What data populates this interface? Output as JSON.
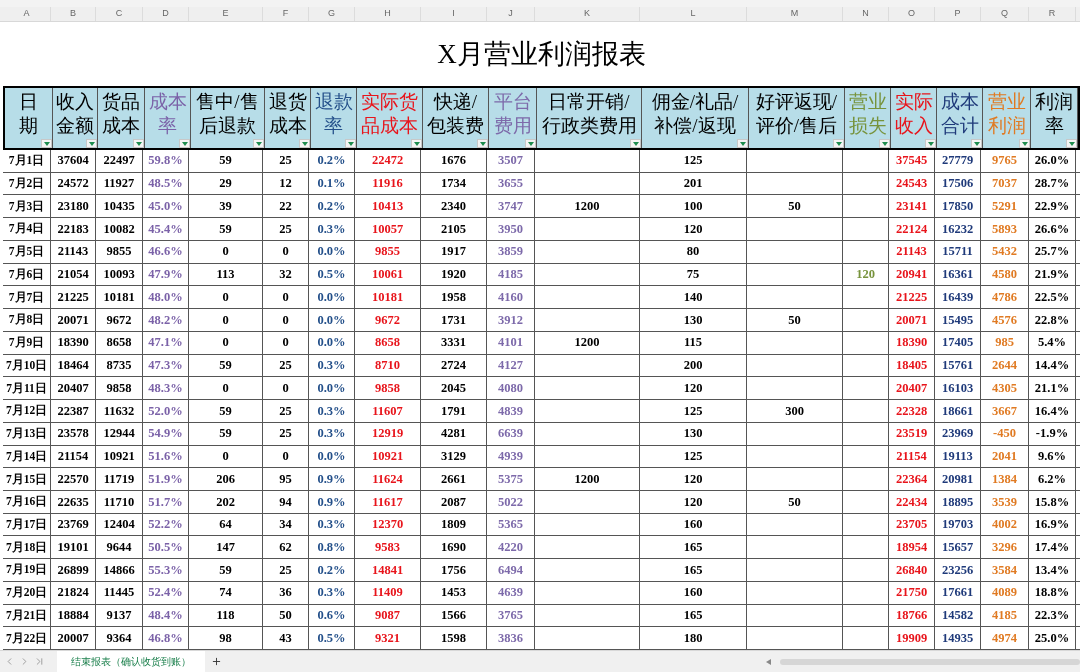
{
  "title": "X月营业利润报表",
  "columns": [
    {
      "letter": "A",
      "header_lines": [
        "日",
        "期"
      ],
      "color": "#000000"
    },
    {
      "letter": "B",
      "header_lines": [
        "收入",
        "金额"
      ],
      "color": "#000000"
    },
    {
      "letter": "C",
      "header_lines": [
        "货品",
        "成本"
      ],
      "color": "#000000"
    },
    {
      "letter": "D",
      "header_lines": [
        "成本",
        "率"
      ],
      "color": "#7b62a8"
    },
    {
      "letter": "E",
      "header_lines": [
        "售中/售",
        "后退款"
      ],
      "color": "#000000"
    },
    {
      "letter": "F",
      "header_lines": [
        "退货",
        "成本"
      ],
      "color": "#000000"
    },
    {
      "letter": "G",
      "header_lines": [
        "退款",
        "率"
      ],
      "color": "#24508a"
    },
    {
      "letter": "H",
      "header_lines": [
        "实际货",
        "品成本"
      ],
      "color": "#e8141b"
    },
    {
      "letter": "I",
      "header_lines": [
        "快递/",
        "包装费"
      ],
      "color": "#000000"
    },
    {
      "letter": "J",
      "header_lines": [
        "平台",
        "费用"
      ],
      "color": "#7d6aaa"
    },
    {
      "letter": "K",
      "header_lines": [
        "日常开销/",
        "行政类费用"
      ],
      "color": "#000000"
    },
    {
      "letter": "L",
      "header_lines": [
        "佣金/礼品/",
        "补偿/返现"
      ],
      "color": "#000000"
    },
    {
      "letter": "M",
      "header_lines": [
        "好评返现/",
        "评价/售后"
      ],
      "color": "#000000"
    },
    {
      "letter": "N",
      "header_lines": [
        "营业",
        "损失"
      ],
      "color": "#77933c"
    },
    {
      "letter": "O",
      "header_lines": [
        "实际",
        "收入"
      ],
      "color": "#e8141b"
    },
    {
      "letter": "P",
      "header_lines": [
        "成本",
        "合计"
      ],
      "color": "#1f3a7a"
    },
    {
      "letter": "Q",
      "header_lines": [
        "营业",
        "利润"
      ],
      "color": "#e07a22"
    },
    {
      "letter": "R",
      "header_lines": [
        "利润",
        "率"
      ],
      "color": "#000000"
    }
  ],
  "rows": [
    [
      "7月1日",
      "37604",
      "22497",
      "59.8%",
      "59",
      "25",
      "0.2%",
      "22472",
      "1676",
      "3507",
      null,
      "125",
      null,
      null,
      "37545",
      "27779",
      "9765",
      "26.0%"
    ],
    [
      "7月2日",
      "24572",
      "11927",
      "48.5%",
      "29",
      "12",
      "0.1%",
      "11916",
      "1734",
      "3655",
      null,
      "201",
      null,
      null,
      "24543",
      "17506",
      "7037",
      "28.7%"
    ],
    [
      "7月3日",
      "23180",
      "10435",
      "45.0%",
      "39",
      "22",
      "0.2%",
      "10413",
      "2340",
      "3747",
      "1200",
      "100",
      "50",
      null,
      "23141",
      "17850",
      "5291",
      "22.9%"
    ],
    [
      "7月4日",
      "22183",
      "10082",
      "45.4%",
      "59",
      "25",
      "0.3%",
      "10057",
      "2105",
      "3950",
      null,
      "120",
      null,
      null,
      "22124",
      "16232",
      "5893",
      "26.6%"
    ],
    [
      "7月5日",
      "21143",
      "9855",
      "46.6%",
      "0",
      "0",
      "0.0%",
      "9855",
      "1917",
      "3859",
      null,
      "80",
      null,
      null,
      "21143",
      "15711",
      "5432",
      "25.7%"
    ],
    [
      "7月6日",
      "21054",
      "10093",
      "47.9%",
      "113",
      "32",
      "0.5%",
      "10061",
      "1920",
      "4185",
      null,
      "75",
      null,
      "120",
      "20941",
      "16361",
      "4580",
      "21.9%"
    ],
    [
      "7月7日",
      "21225",
      "10181",
      "48.0%",
      "0",
      "0",
      "0.0%",
      "10181",
      "1958",
      "4160",
      null,
      "140",
      null,
      null,
      "21225",
      "16439",
      "4786",
      "22.5%"
    ],
    [
      "7月8日",
      "20071",
      "9672",
      "48.2%",
      "0",
      "0",
      "0.0%",
      "9672",
      "1731",
      "3912",
      null,
      "130",
      "50",
      null,
      "20071",
      "15495",
      "4576",
      "22.8%"
    ],
    [
      "7月9日",
      "18390",
      "8658",
      "47.1%",
      "0",
      "0",
      "0.0%",
      "8658",
      "3331",
      "4101",
      "1200",
      "115",
      null,
      null,
      "18390",
      "17405",
      "985",
      "5.4%"
    ],
    [
      "7月10日",
      "18464",
      "8735",
      "47.3%",
      "59",
      "25",
      "0.3%",
      "8710",
      "2724",
      "4127",
      null,
      "200",
      null,
      null,
      "18405",
      "15761",
      "2644",
      "14.4%"
    ],
    [
      "7月11日",
      "20407",
      "9858",
      "48.3%",
      "0",
      "0",
      "0.0%",
      "9858",
      "2045",
      "4080",
      null,
      "120",
      null,
      null,
      "20407",
      "16103",
      "4305",
      "21.1%"
    ],
    [
      "7月12日",
      "22387",
      "11632",
      "52.0%",
      "59",
      "25",
      "0.3%",
      "11607",
      "1791",
      "4839",
      null,
      "125",
      "300",
      null,
      "22328",
      "18661",
      "3667",
      "16.4%"
    ],
    [
      "7月13日",
      "23578",
      "12944",
      "54.9%",
      "59",
      "25",
      "0.3%",
      "12919",
      "4281",
      "6639",
      null,
      "130",
      null,
      null,
      "23519",
      "23969",
      "-450",
      "-1.9%"
    ],
    [
      "7月14日",
      "21154",
      "10921",
      "51.6%",
      "0",
      "0",
      "0.0%",
      "10921",
      "3129",
      "4939",
      null,
      "125",
      null,
      null,
      "21154",
      "19113",
      "2041",
      "9.6%"
    ],
    [
      "7月15日",
      "22570",
      "11719",
      "51.9%",
      "206",
      "95",
      "0.9%",
      "11624",
      "2661",
      "5375",
      "1200",
      "120",
      null,
      null,
      "22364",
      "20981",
      "1384",
      "6.2%"
    ],
    [
      "7月16日",
      "22635",
      "11710",
      "51.7%",
      "202",
      "94",
      "0.9%",
      "11617",
      "2087",
      "5022",
      null,
      "120",
      "50",
      null,
      "22434",
      "18895",
      "3539",
      "15.8%"
    ],
    [
      "7月17日",
      "23769",
      "12404",
      "52.2%",
      "64",
      "34",
      "0.3%",
      "12370",
      "1809",
      "5365",
      null,
      "160",
      null,
      null,
      "23705",
      "19703",
      "4002",
      "16.9%"
    ],
    [
      "7月18日",
      "19101",
      "9644",
      "50.5%",
      "147",
      "62",
      "0.8%",
      "9583",
      "1690",
      "4220",
      null,
      "165",
      null,
      null,
      "18954",
      "15657",
      "3296",
      "17.4%"
    ],
    [
      "7月19日",
      "26899",
      "14866",
      "55.3%",
      "59",
      "25",
      "0.2%",
      "14841",
      "1756",
      "6494",
      null,
      "165",
      null,
      null,
      "26840",
      "23256",
      "3584",
      "13.4%"
    ],
    [
      "7月20日",
      "21824",
      "11445",
      "52.4%",
      "74",
      "36",
      "0.3%",
      "11409",
      "1453",
      "4639",
      null,
      "160",
      null,
      null,
      "21750",
      "17661",
      "4089",
      "18.8%"
    ],
    [
      "7月21日",
      "18884",
      "9137",
      "48.4%",
      "118",
      "50",
      "0.6%",
      "9087",
      "1566",
      "3765",
      null,
      "165",
      null,
      null,
      "18766",
      "14582",
      "4185",
      "22.3%"
    ],
    [
      "7月22日",
      "20007",
      "9364",
      "46.8%",
      "98",
      "43",
      "0.5%",
      "9321",
      "1598",
      "3836",
      null,
      "180",
      null,
      null,
      "19909",
      "14935",
      "4974",
      "25.0%"
    ]
  ],
  "sheet_tabs": [
    {
      "label": "结束报表（确认收货到账）",
      "selected": true
    }
  ]
}
